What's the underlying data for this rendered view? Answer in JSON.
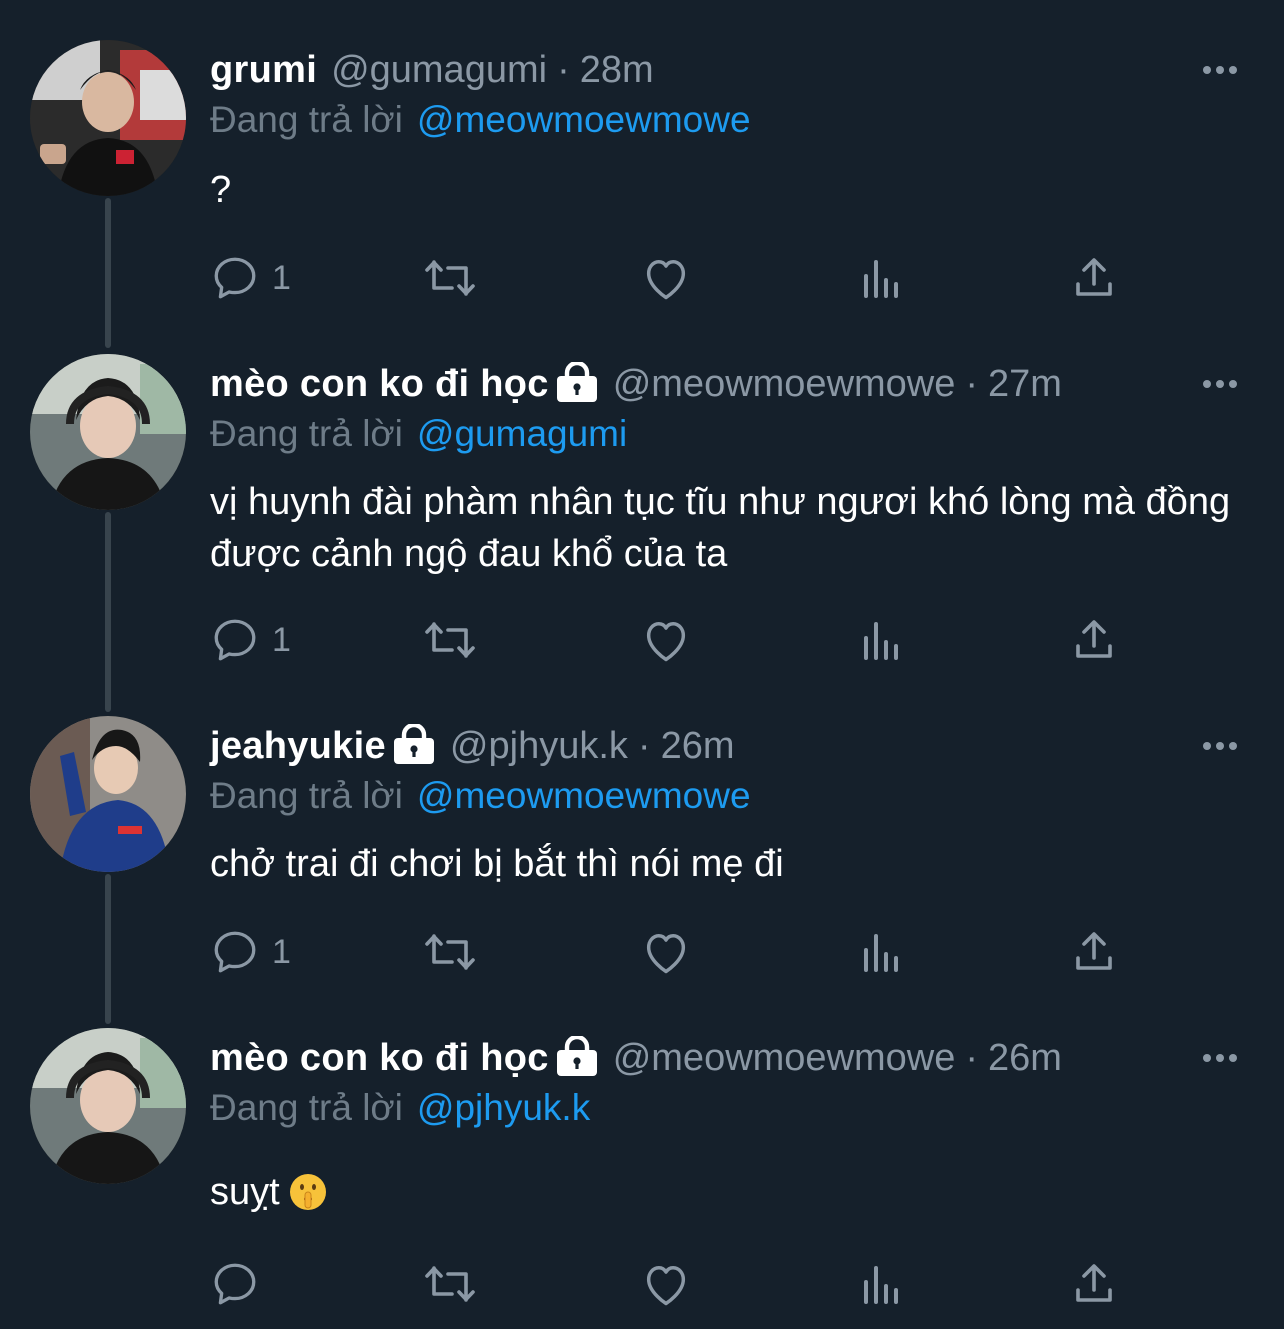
{
  "colors": {
    "background": "#15202b",
    "name": "#ffffff",
    "secondary": "#8b98a5",
    "mention": "#1d9bf0",
    "connector": "#38444d"
  },
  "tweets": [
    {
      "name": "grumi",
      "protected": false,
      "handle": "@gumagumi",
      "separator": "·",
      "time": "28m",
      "reply_label": "Đang trả lời",
      "reply_to": "@meowmoewmowe",
      "text": "?",
      "reply_count": "1",
      "avatar_icon": "user-avatar-photo"
    },
    {
      "name": "mèo con ko đi học",
      "protected": true,
      "handle": "@meowmoewmowe",
      "separator": "·",
      "time": "27m",
      "reply_label": "Đang trả lời",
      "reply_to": "@gumagumi",
      "text": "vị huynh đài phàm nhân tục tĩu như ngươi khó lòng mà đồng được cảnh ngộ đau khổ của ta",
      "reply_count": "1",
      "avatar_icon": "user-avatar-photo"
    },
    {
      "name": "jeahyukie",
      "protected": true,
      "handle": "@pjhyuk.k",
      "separator": "·",
      "time": "26m",
      "reply_label": "Đang trả lời",
      "reply_to": "@meowmoewmowe",
      "text": "chở trai đi chơi bị bắt thì nói mẹ đi",
      "reply_count": "1",
      "avatar_icon": "user-avatar-photo"
    },
    {
      "name": "mèo con ko đi học",
      "protected": true,
      "handle": "@meowmoewmowe",
      "separator": "·",
      "time": "26m",
      "reply_label": "Đang trả lời",
      "reply_to": "@pjhyuk.k",
      "text": "suỵt",
      "emoji": "shushing-face-emoji",
      "reply_count": "",
      "avatar_icon": "user-avatar-photo"
    }
  ],
  "icons": {
    "reply": "reply-icon",
    "retweet": "retweet-icon",
    "like": "like-icon",
    "views": "views-icon",
    "share": "share-icon",
    "more": "more-icon",
    "lock": "lock-icon"
  }
}
